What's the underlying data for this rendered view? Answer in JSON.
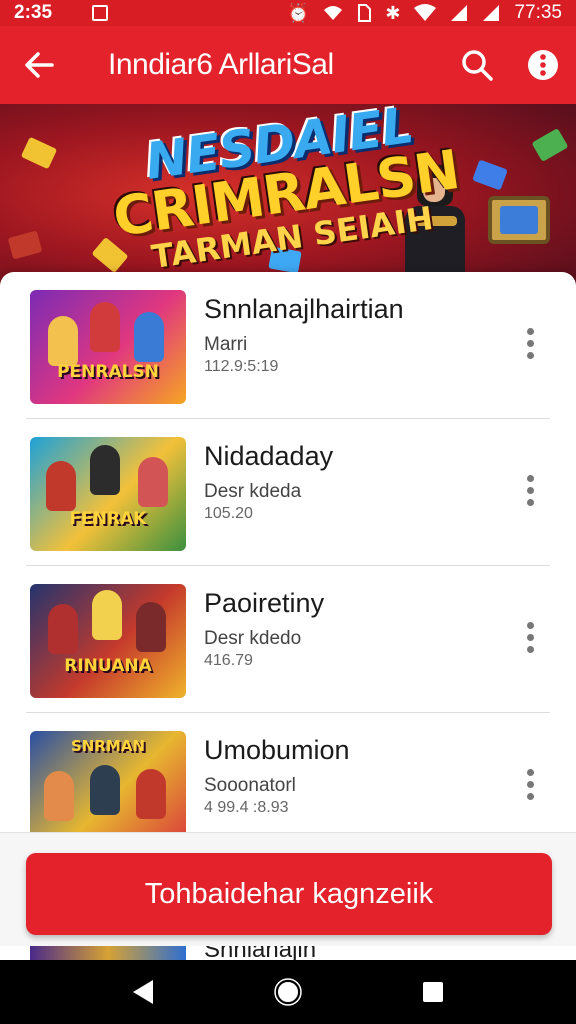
{
  "status_bar": {
    "time": "2:35",
    "right_time": "77:35",
    "icons": [
      "notification-icon",
      "wifi-icon",
      "sim-icon",
      "bluetooth-icon",
      "signal-icon",
      "signal-icon",
      "battery-icon"
    ]
  },
  "app_bar": {
    "title": "Inndiar6 ArllariSal",
    "back_icon": "arrow-back-icon",
    "search_icon": "search-icon",
    "more_icon": "info-more-icon",
    "color": "#e3222b"
  },
  "banner": {
    "line1": "NESDAIEL",
    "line2": "CRIMRALSN",
    "line3": "TARMAN SEIAIH"
  },
  "list": {
    "items": [
      {
        "title": "Snnlanajlhairtian",
        "subtitle": "Marri",
        "meta": "112.9:5:19",
        "thumb_text": "PENRALSN",
        "thumb_colors": [
          "#7b2bb5",
          "#e0377f",
          "#f6a623"
        ]
      },
      {
        "title": "Nidadaday",
        "subtitle": "Desr kdeda",
        "meta": "105.20",
        "thumb_text": "FENRAK",
        "thumb_colors": [
          "#1da1d8",
          "#f3c13a",
          "#3a8f3f"
        ]
      },
      {
        "title": "Paoiretiny",
        "subtitle": "Desr kdedo",
        "meta": "416.79",
        "thumb_text": "RINUANA",
        "thumb_colors": [
          "#23346e",
          "#c53a2c",
          "#f0b32c"
        ]
      },
      {
        "title": "Umobumion",
        "subtitle": "Sooonatorl",
        "meta": "4 99.4 :8.93",
        "thumb_text": "SNRMAN",
        "thumb_colors": [
          "#2a4fa3",
          "#e7b730",
          "#d93b3b"
        ]
      }
    ],
    "peek_title": "Snnlanajlh"
  },
  "cta": {
    "label": "Tohbaidehar kagnzeiik"
  },
  "nav_bar": {
    "back_icon": "triangle-back-icon",
    "home_icon": "circle-home-icon",
    "recents_icon": "square-recents-icon"
  }
}
